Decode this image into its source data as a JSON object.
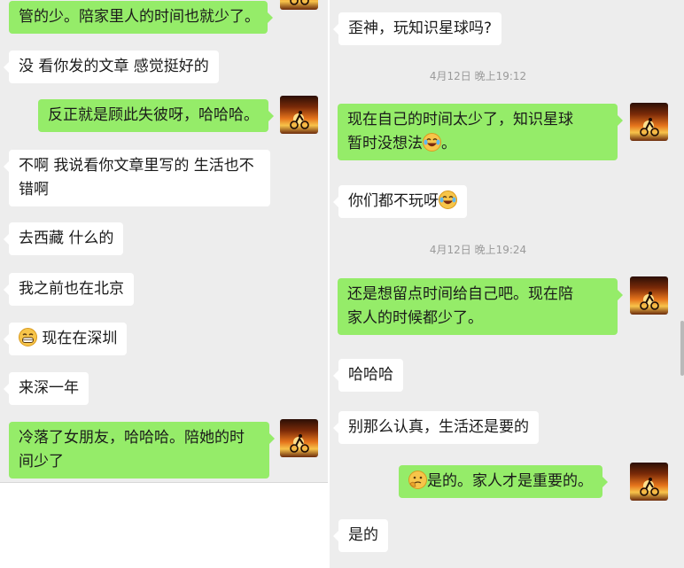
{
  "left": {
    "messages": [
      {
        "side": "out",
        "text": "管的少。陪家里人的时间也就少了。"
      },
      {
        "side": "in",
        "text": "没 看你发的文章 感觉挺好的"
      },
      {
        "side": "out",
        "text": "反正就是顾此失彼呀，哈哈哈。"
      },
      {
        "side": "in",
        "line1": "不啊 我说看你文章里写的 生活也不",
        "line2": "错啊"
      },
      {
        "side": "in",
        "text": "去西藏 什么的"
      },
      {
        "side": "in",
        "text": "我之前也在北京"
      },
      {
        "side": "in",
        "emoji": "grin-emoji",
        "text": " 现在在深圳"
      },
      {
        "side": "in",
        "text": "来深一年"
      },
      {
        "side": "out",
        "line1": "冷落了女朋友，哈哈哈。陪她的时",
        "line2": "间少了"
      }
    ]
  },
  "right": {
    "messages": [
      {
        "side": "in",
        "text": "歪神，玩知识星球吗?"
      },
      {
        "type": "timestamp",
        "text": "4月12日 晚上19:12"
      },
      {
        "side": "out",
        "line1": "现在自己的时间太少了，知识星球",
        "line2a": "暂时没想法",
        "emoji": "laugh-tears-emoji",
        "line2b": "。"
      },
      {
        "side": "in",
        "text": "你们都不玩呀",
        "emoji": "laugh-tears-emoji"
      },
      {
        "type": "timestamp",
        "text": "4月12日 晚上19:24"
      },
      {
        "side": "out",
        "line1": "还是想留点时间给自己吧。现在陪",
        "line2": "家人的时候都少了。"
      },
      {
        "side": "in",
        "text": "哈哈哈"
      },
      {
        "side": "in",
        "text": "别那么认真，生活还是要的"
      },
      {
        "side": "out",
        "emoji": "thinking-emoji",
        "text": "是的。家人才是重要的。"
      },
      {
        "side": "in",
        "text": "是的"
      }
    ]
  },
  "colors": {
    "outgoing_bubble": "#95ec69",
    "incoming_bubble": "#ffffff",
    "chat_bg": "#ededed",
    "timestamp": "#9a9a9a"
  }
}
